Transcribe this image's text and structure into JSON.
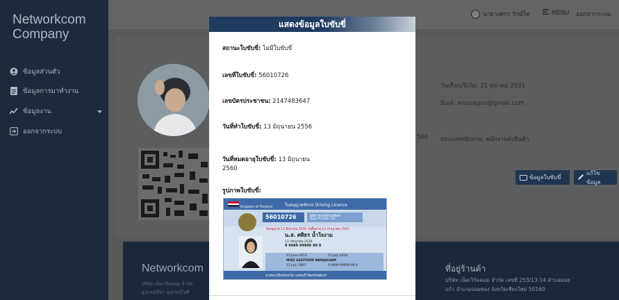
{
  "sidebar": {
    "brand": "Networkcom Company",
    "items": [
      {
        "label": "ข้อมูลส่วนตัว",
        "icon": "user-circle-icon"
      },
      {
        "label": "ข้อมูลการมาทำงาน",
        "icon": "file-icon"
      },
      {
        "label": "ข้อมูลงาน",
        "icon": "chart-line-icon"
      },
      {
        "label": "ออกจากระบบ",
        "icon": "sign-out-icon"
      }
    ]
  },
  "topbar": {
    "user_name": "นายวงศกร รักษ์ไท",
    "menu_label": "MENU",
    "logout_label": "ออกจากระบบ"
  },
  "profile": {
    "birthday": "วันเดือน/ปีเกิด: 21 ตุลาคม 2531",
    "email": "อีเมล์: wonsagon@gmail.com",
    "phone_partial": "560",
    "employee_type": "ประเภทพนักงาน: พนักงานส่งสินค้า",
    "license_button": "ข้อมูลใบขับขี่",
    "edit_button": "แก้ไขข้อมูล"
  },
  "footer": {
    "brand": "Networkcom",
    "line1": "บริษัท เน็ตเวิร์คคอม จำกัด",
    "line2": "อุปกรณ์กีฬา อุปกรณ์ไอที",
    "address_title": "ที่อยู่ร้านค้า",
    "address_line1": "บริษัท เน็ตเวิร์คคอม จำกัด เลขที่ 253/13-14 ตำบลดอย",
    "address_line2": "แก้ว อำเภอจอมทอง จังหวัดเชียงใหม่ 50160"
  },
  "modal": {
    "title": "แสดงข้อมูลใบขับขี่",
    "fields": [
      {
        "label": "สถานะใบขับขี่:",
        "value": "ไม่มีใบขับขี่"
      },
      {
        "label": "เลขที่ใบขับขี่:",
        "value": "56010726"
      },
      {
        "label": "เลขบัตรประชาชน:",
        "value": "2147483647"
      },
      {
        "label": "วันที่ทำใบขับขี่:",
        "value": "13 มิถุนายน 2556"
      },
      {
        "label": "วันที่หมดอายุใบขับขี่:",
        "value": "13 มิถุนายน 2560"
      },
      {
        "label": "รูปภาพใบขับขี่:",
        "value": ""
      }
    ],
    "license_card": {
      "header": "ใบอนุญาตขับรถ Driving Licence",
      "kingdom": "Kingdom of Thailand",
      "number": "56010726",
      "type_label": "ชนิด รถยนต์ส่วนบุคคล",
      "type_en": "Type Private Car",
      "issue_line": "วันอนุญาต 13 มิถุนายน 2556   วันสิ้นอายุ 13 กรกฎาคม 2561",
      "name_th": "น.ส. ศศิธร น้ำใจงาม",
      "birth_th": "13 กรกฎาคม 2520",
      "id_line": "9 9999 99999 99 9",
      "issue_date": "13 June 2013",
      "expiry_date": "13 July 2018",
      "name_en": "MISS SASITHON NAMJAIGAM",
      "birth_en": "13 July 1983",
      "id_en": "9 9999 99999 99 9",
      "issuer": "นายทะเบียนจังหวัด นนทบุรี Nonthaburi"
    }
  },
  "colors": {
    "sidebar": "#1d2a3a",
    "modal_header": "#1e3a5f",
    "overlay": "#58595b",
    "button": "#1f3552"
  }
}
